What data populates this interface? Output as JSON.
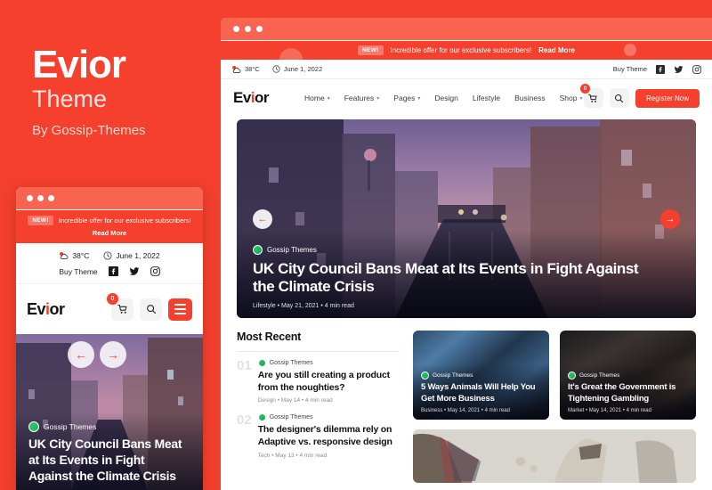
{
  "promo": {
    "brand": "Evior",
    "subtitle": "Theme",
    "byline": "By Gossip-Themes",
    "accent_color": "#f4402c"
  },
  "announcement": {
    "badge": "NEW!",
    "text": "Incredible offer for our exclusive subscribers!",
    "link_label": "Read More"
  },
  "topbar": {
    "weather": "38°C",
    "date": "June 1, 2022",
    "buy_theme_label": "Buy Theme",
    "socials": [
      "facebook-icon",
      "twitter-icon",
      "instagram-icon"
    ]
  },
  "nav": {
    "logo": "Evior",
    "items": [
      {
        "label": "Home",
        "has_dropdown": true
      },
      {
        "label": "Features",
        "has_dropdown": true
      },
      {
        "label": "Pages",
        "has_dropdown": true
      },
      {
        "label": "Design",
        "has_dropdown": false
      },
      {
        "label": "Lifestyle",
        "has_dropdown": false
      },
      {
        "label": "Business",
        "has_dropdown": false
      },
      {
        "label": "Shop",
        "has_dropdown": true
      }
    ],
    "cart_count": "0",
    "search_icon": "search-icon",
    "cta_label": "Register Now"
  },
  "hero": {
    "author": "Gossip Themes",
    "title": "UK City Council Bans Meat at Its Events in Fight Against the Climate Crisis",
    "category": "Lifestyle",
    "date": "May 21, 2021",
    "read_time": "4 min read",
    "meta": "Lifestyle • May 21, 2021 • 4 min read",
    "prev_label": "←",
    "next_label": "→"
  },
  "most_recent": {
    "heading": "Most Recent",
    "items": [
      {
        "number": "01",
        "author": "Gossip Themes",
        "title": "Are you still creating a product from the noughties?",
        "meta": "Design • May 14 • 4 min read"
      },
      {
        "number": "02",
        "author": "Gossip Themes",
        "title": "The designer's dilemma rely on Adaptive vs. responsive design",
        "meta": "Tech • May 13 • 4 min read"
      }
    ]
  },
  "cards": [
    {
      "author": "Gossip Themes",
      "title": "5 Ways Animals Will Help You Get More Business",
      "meta": "Business • May 14, 2021 • 4 min read"
    },
    {
      "author": "Gossip Themes",
      "title": "It's Great the Government is Tightening Gambling",
      "meta": "Market • May 14, 2021 • 4 min read"
    }
  ],
  "mobile": {
    "logo": "Evior",
    "cart_count": "0",
    "menu_icon": "hamburger-icon",
    "hero": {
      "author": "Gossip Themes",
      "title": "UK City Council Bans Meat at Its Events in Fight Against the Climate Crisis"
    }
  }
}
